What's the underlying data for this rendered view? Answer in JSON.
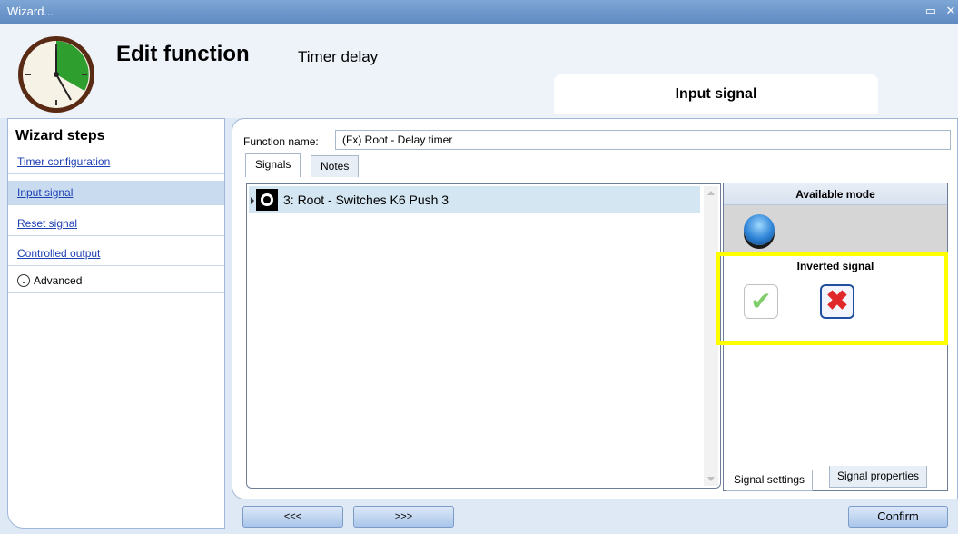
{
  "window": {
    "title": "Wizard..."
  },
  "header": {
    "title": "Edit function",
    "subtitle": "Timer delay",
    "current_step": "Input signal"
  },
  "sidebar": {
    "title": "Wizard steps",
    "items": [
      {
        "label": "Timer configuration",
        "active": false
      },
      {
        "label": "Input signal",
        "active": true
      },
      {
        "label": "Reset signal",
        "active": false
      },
      {
        "label": "Controlled output",
        "active": false
      }
    ],
    "advanced_label": "Advanced"
  },
  "form": {
    "function_name_label": "Function name:",
    "function_name_value": "(Fx) Root - Delay timer"
  },
  "tabs": [
    {
      "label": "Signals",
      "active": true
    },
    {
      "label": "Notes",
      "active": false
    }
  ],
  "signals": [
    {
      "label": "3: Root - Switches K6 Push 3"
    }
  ],
  "mode_panel": {
    "available_mode_title": "Available mode",
    "inverted_signal_title": "Inverted signal",
    "inverted_yes_icon": "check-icon",
    "inverted_no_icon": "cross-icon",
    "inverted_selected": "no"
  },
  "bottom_tabs": [
    {
      "label": "Signal settings",
      "active": true
    },
    {
      "label": "Signal properties",
      "active": false
    }
  ],
  "buttons": {
    "prev": "<<<",
    "next": ">>>",
    "confirm": "Confirm"
  },
  "colors": {
    "highlight": "#ffff00",
    "link": "#1d3fb4"
  }
}
